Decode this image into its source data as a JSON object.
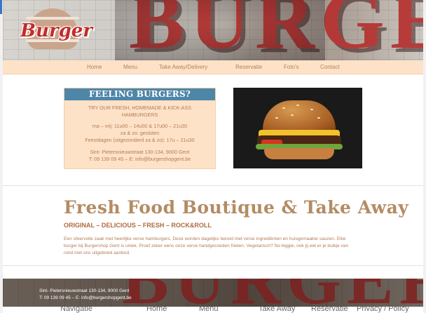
{
  "header": {
    "logo_text": "Burger",
    "banner_text": "BURGERS"
  },
  "nav": {
    "items": [
      {
        "label": "Home"
      },
      {
        "label": "Menu"
      },
      {
        "label": "Take Away/Delivery"
      },
      {
        "label": "Reservatie"
      },
      {
        "label": "Foto's"
      },
      {
        "label": "Contact"
      }
    ]
  },
  "promo": {
    "title": "FEELING BURGERS?",
    "tagline_1": "TRY OUR FRESH, HOMEMADE & KICK-ASS",
    "tagline_2": "HAMBURGERS",
    "hours_1": "ma – vrij: 11u00 – 14u00 & 17u00 – 21u30",
    "hours_2": "za & zo: gesloten",
    "hours_3": "Feestdagen (uitgezonderd za & zo): 17u – 21u30",
    "address": "Sint- Pietersnieuwstraat 130-134, 9000 Gent",
    "contact": "T: 09 139 09 45 – E: info@burgershopgent.be"
  },
  "main": {
    "headline": "Fresh Food Boutique & Take Away",
    "subhead": "ORIGINAL – DELICIOUS – FRESH – ROCK&ROLL",
    "body": "Een sfeervolle zaak met heerlijke verse hamburgers. Deze worden dagelijks bereid met verse ingrediënten en huisgemaakte sauzen. Elke burger bij Burgershop Gent is uniek. Proef zeker eens onze verse handgesneden frieten. Vegetarisch? No biggie, ook jij eet er je buikje van rond met ons uitgebreid aanbod."
  },
  "footer": {
    "address": "Sint- Pietersnieuwstraat 130-134, 9000 Gent",
    "contact": "T: 09 139 09 45 – E: info@burgershopgent.be",
    "banner_text": "BURGERS"
  },
  "bottom_strip": {
    "items": [
      "Navigatie",
      "Home",
      "Menu",
      "Take Away",
      "Reservatie",
      "Privacy / Policy"
    ]
  },
  "colors": {
    "nav_bg": "#fde2c7",
    "accent_text": "#b57c57",
    "title_bar": "#4e86a8",
    "headline": "#b48b63"
  }
}
